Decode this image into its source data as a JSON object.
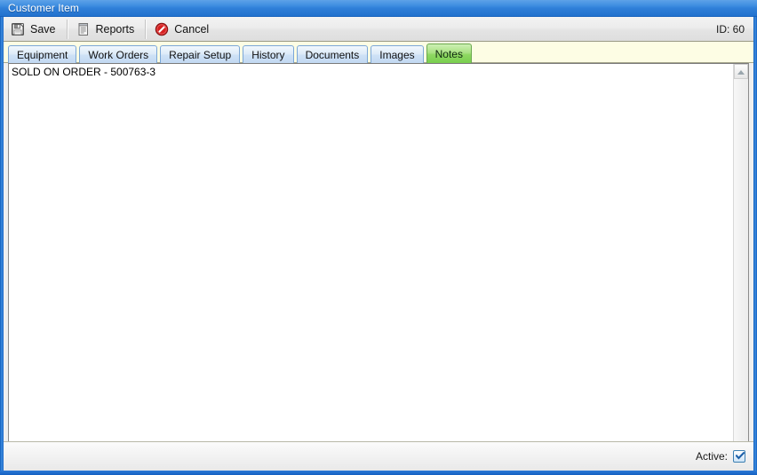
{
  "window": {
    "title": "Customer Item"
  },
  "toolbar": {
    "buttons": [
      {
        "label": "Save",
        "icon": "floppy-disk-icon"
      },
      {
        "label": "Reports",
        "icon": "report-document-icon"
      },
      {
        "label": "Cancel",
        "icon": "cancel-circle-icon"
      }
    ],
    "id_text": "ID: 60"
  },
  "tabs": {
    "items": [
      {
        "label": "Equipment",
        "active": false
      },
      {
        "label": "Work Orders",
        "active": false
      },
      {
        "label": "Repair Setup",
        "active": false
      },
      {
        "label": "History",
        "active": false
      },
      {
        "label": "Documents",
        "active": false
      },
      {
        "label": "Images",
        "active": false
      },
      {
        "label": "Notes",
        "active": true
      }
    ],
    "active_label": "Notes"
  },
  "notes": {
    "text": "SOLD ON ORDER - 500763-3"
  },
  "scrollbar": {
    "up_icon": "scroll-up-arrow-icon",
    "down_icon": "scroll-down-arrow-icon"
  },
  "statusbar": {
    "active_label": "Active:",
    "active_checked": true
  },
  "colors": {
    "titlebar_blue": "#3c8ce0",
    "frame_blue": "#1461c2",
    "tab_blue": "#cfe2f6",
    "tab_active_green": "#8ed862",
    "tabstrip_cream": "#fdfde4",
    "cancel_red": "#d62020",
    "checkbox_blue": "#3c7fb1"
  }
}
